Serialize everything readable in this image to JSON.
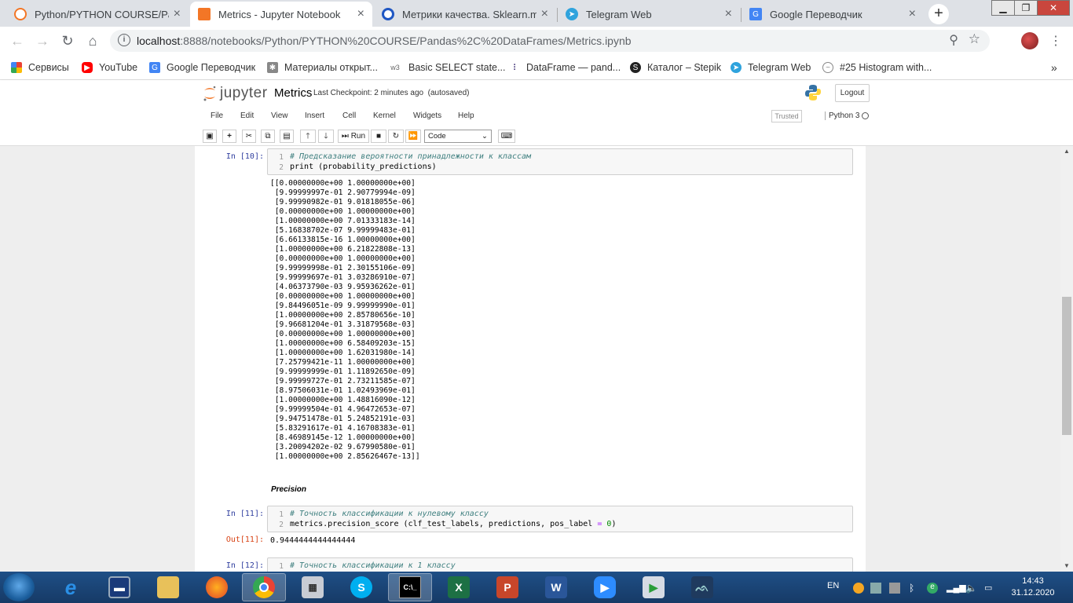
{
  "browser": {
    "tabs": [
      {
        "title": "Python/PYTHON COURSE/Pand",
        "icon": "jupyter-icon",
        "active": false
      },
      {
        "title": "Metrics - Jupyter Notebook",
        "icon": "jupyter-icon",
        "active": true
      },
      {
        "title": "Метрики качества. Sklearn.met",
        "icon": "coursera-icon",
        "active": false
      },
      {
        "title": "Telegram Web",
        "icon": "telegram-icon",
        "active": false
      },
      {
        "title": "Google Переводчик",
        "icon": "google-translate-icon",
        "active": false
      }
    ],
    "new_tab_label": "+",
    "url_host": "localhost",
    "url_rest": ":8888/notebooks/Python/PYTHON%20COURSE/Pandas%2C%20DataFrames/Metrics.ipynb",
    "bookmarks": [
      "Сервисы",
      "YouTube",
      "Google Переводчик",
      "Материалы открыт...",
      "Basic SELECT state...",
      "DataFrame — pand...",
      "Каталог – Stepik",
      "Telegram Web",
      "#25 Histogram with..."
    ],
    "bookmarks_overflow": "»"
  },
  "jupyter": {
    "logo_text": "jupyter",
    "notebook_name": "Metrics",
    "checkpoint": "Last Checkpoint: 2 minutes ago",
    "autosave": "(autosaved)",
    "logout_label": "Logout",
    "menu": [
      "File",
      "Edit",
      "View",
      "Insert",
      "Cell",
      "Kernel",
      "Widgets",
      "Help"
    ],
    "trusted_label": "Trusted",
    "kernel_name": "Python 3",
    "run_label": "Run",
    "cell_type": "Code"
  },
  "cells": {
    "cell10": {
      "prompt": "In [10]:",
      "lines": [
        {
          "num": "1",
          "comment": "# Предсказание вероятности принадлежности к классам"
        },
        {
          "num": "2",
          "code": "print (probability_predictions)"
        }
      ],
      "output": [
        "[[0.00000000e+00 1.00000000e+00]",
        " [9.99999997e-01 2.90779994e-09]",
        " [9.99990982e-01 9.01818055e-06]",
        " [0.00000000e+00 1.00000000e+00]",
        " [1.00000000e+00 7.01333183e-14]",
        " [5.16838702e-07 9.99999483e-01]",
        " [6.66133815e-16 1.00000000e+00]",
        " [1.00000000e+00 6.21822808e-13]",
        " [0.00000000e+00 1.00000000e+00]",
        " [9.99999998e-01 2.30155106e-09]",
        " [9.99999697e-01 3.03286910e-07]",
        " [4.06373790e-03 9.95936262e-01]",
        " [0.00000000e+00 1.00000000e+00]",
        " [9.84496051e-09 9.99999990e-01]",
        " [1.00000000e+00 2.85780656e-10]",
        " [9.96681204e-01 3.31879568e-03]",
        " [0.00000000e+00 1.00000000e+00]",
        " [1.00000000e+00 6.58409203e-15]",
        " [1.00000000e+00 1.62031980e-14]",
        " [7.25799421e-11 1.00000000e+00]",
        " [9.99999999e-01 1.11892650e-09]",
        " [9.99999727e-01 2.73211585e-07]",
        " [8.97506031e-01 1.02493969e-01]",
        " [1.00000000e+00 1.48816090e-12]",
        " [9.99999504e-01 4.96472653e-07]",
        " [9.94751478e-01 5.24852191e-03]",
        " [5.83291617e-01 4.16708383e-01]",
        " [8.46989145e-12 1.00000000e+00]",
        " [3.20094202e-02 9.67990580e-01]",
        " [1.00000000e+00 2.85626467e-13]]"
      ]
    },
    "markdown_heading": "Precision",
    "cell11": {
      "prompt": "In [11]:",
      "out_prompt": "Out[11]:",
      "line1_num": "1",
      "line1_comment": "# Точность классификации к нулевому классу",
      "line2_num": "2",
      "line2_code_a": "metrics.precision_score (clf_test_labels, predictions, pos_label ",
      "line2_op": "=",
      "line2_sp": " ",
      "line2_num_val": "0",
      "line2_close": ")",
      "output": "0.9444444444444444"
    },
    "cell12": {
      "prompt": "In [12]:",
      "line1_num": "1",
      "line1_comment": "# Точность классификации к 1 классу"
    }
  },
  "taskbar": {
    "language": "EN",
    "time": "14:43",
    "date": "31.12.2020"
  },
  "colors": {
    "prompt_in": "#303f9f",
    "prompt_out": "#d84315",
    "comment": "#408080"
  }
}
